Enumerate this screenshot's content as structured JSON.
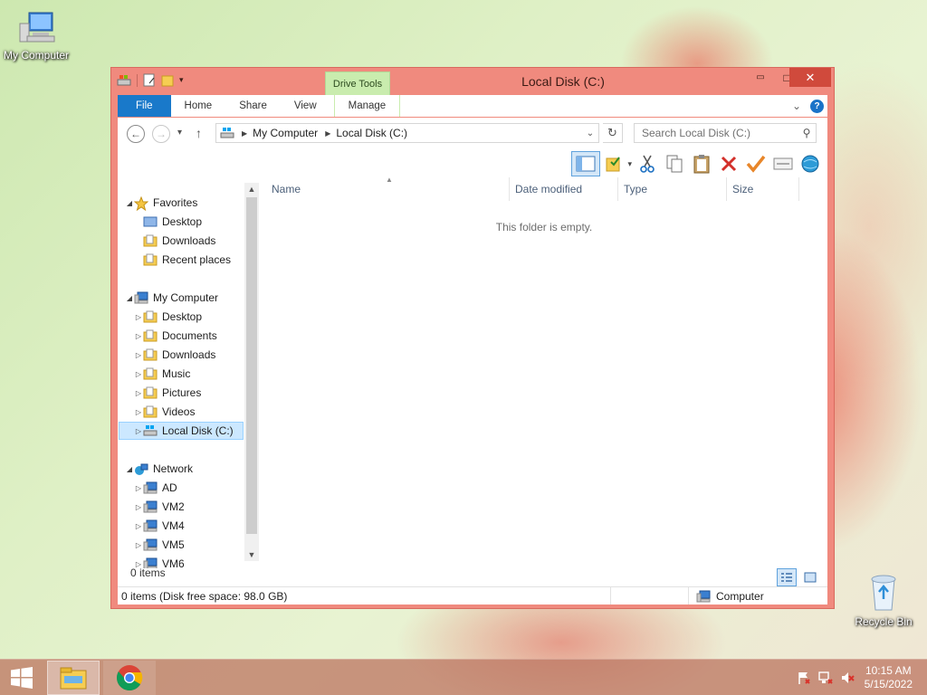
{
  "desktop": {
    "icons": [
      {
        "label": "My Computer",
        "icon": "computer-icon"
      },
      {
        "label": "Recycle Bin",
        "icon": "recycle-bin-icon"
      }
    ]
  },
  "window": {
    "title": "Local Disk (C:)",
    "context_tab": "Drive Tools",
    "min_glyph": "▭",
    "max_glyph": "□",
    "close_glyph": "✕",
    "ribbon_tabs": {
      "file": "File",
      "home": "Home",
      "share": "Share",
      "view": "View",
      "manage": "Manage"
    },
    "ribbon_expand_glyph": "⌄",
    "help_glyph": "?",
    "address": {
      "crumbs": [
        "My Computer",
        "Local Disk (C:)"
      ],
      "back_glyph": "←",
      "forward_glyph": "→",
      "recent_glyph": "▾",
      "up_glyph": "↑",
      "dropdown_glyph": "⌄",
      "refresh_glyph": "↻"
    },
    "search": {
      "placeholder": "Search Local Disk (C:)",
      "value": ""
    },
    "nav": {
      "favorites": {
        "label": "Favorites",
        "items": [
          "Desktop",
          "Downloads",
          "Recent places"
        ]
      },
      "computer": {
        "label": "My Computer",
        "items": [
          "Desktop",
          "Documents",
          "Downloads",
          "Music",
          "Pictures",
          "Videos",
          "Local Disk (C:)"
        ]
      },
      "network": {
        "label": "Network",
        "items": [
          "AD",
          "VM2",
          "VM4",
          "VM5",
          "VM6"
        ]
      },
      "item_count": "0 items"
    },
    "columns": [
      "Name",
      "Date modified",
      "Type",
      "Size"
    ],
    "empty_message": "This folder is empty.",
    "status": {
      "left": "0 items (Disk free space: 98.0 GB)",
      "zone": "Computer"
    }
  },
  "taskbar": {
    "apps": [
      {
        "name": "File Explorer",
        "icon": "file-explorer-icon",
        "active": true
      },
      {
        "name": "Google Chrome",
        "icon": "chrome-icon",
        "active": false
      }
    ],
    "clock": {
      "time": "10:15 AM",
      "date": "5/15/2022"
    }
  },
  "colors": {
    "window_frame": "#f08a7e",
    "file_tab": "#1979ca",
    "context_tab": "#c9ecae",
    "selection": "#cce8ff"
  }
}
